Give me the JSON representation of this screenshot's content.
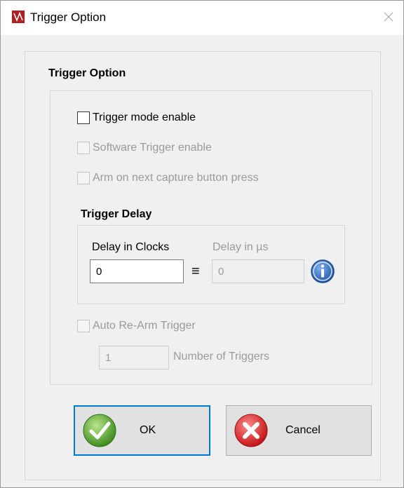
{
  "window": {
    "title": "Trigger Option",
    "close_glyph": "✕"
  },
  "section_title": "Trigger Option",
  "checkboxes": {
    "trigger_mode": {
      "label": "Trigger mode enable",
      "checked": false,
      "enabled": true
    },
    "software_trigger": {
      "label": "Software Trigger enable",
      "checked": false,
      "enabled": false
    },
    "arm_next_capture": {
      "label": "Arm on next capture button press",
      "checked": false,
      "enabled": false
    },
    "auto_rearm": {
      "label": "Auto Re-Arm Trigger",
      "checked": false,
      "enabled": false
    }
  },
  "trigger_delay": {
    "title": "Trigger Delay",
    "clocks_label": "Delay in Clocks",
    "clocks_value": "0",
    "us_label": "Delay in µs",
    "us_value": "0",
    "equiv_glyph": "≡",
    "info_icon": "info-icon"
  },
  "num_triggers": {
    "value": "1",
    "label": "Number of Triggers"
  },
  "buttons": {
    "ok": "OK",
    "cancel": "Cancel"
  },
  "colors": {
    "focus_blue": "#0078d7",
    "ok_green": "#5aa832",
    "cancel_red": "#e12a2a",
    "info_blue": "#2f6cc2",
    "disabled_text": "#9a9a9a"
  }
}
